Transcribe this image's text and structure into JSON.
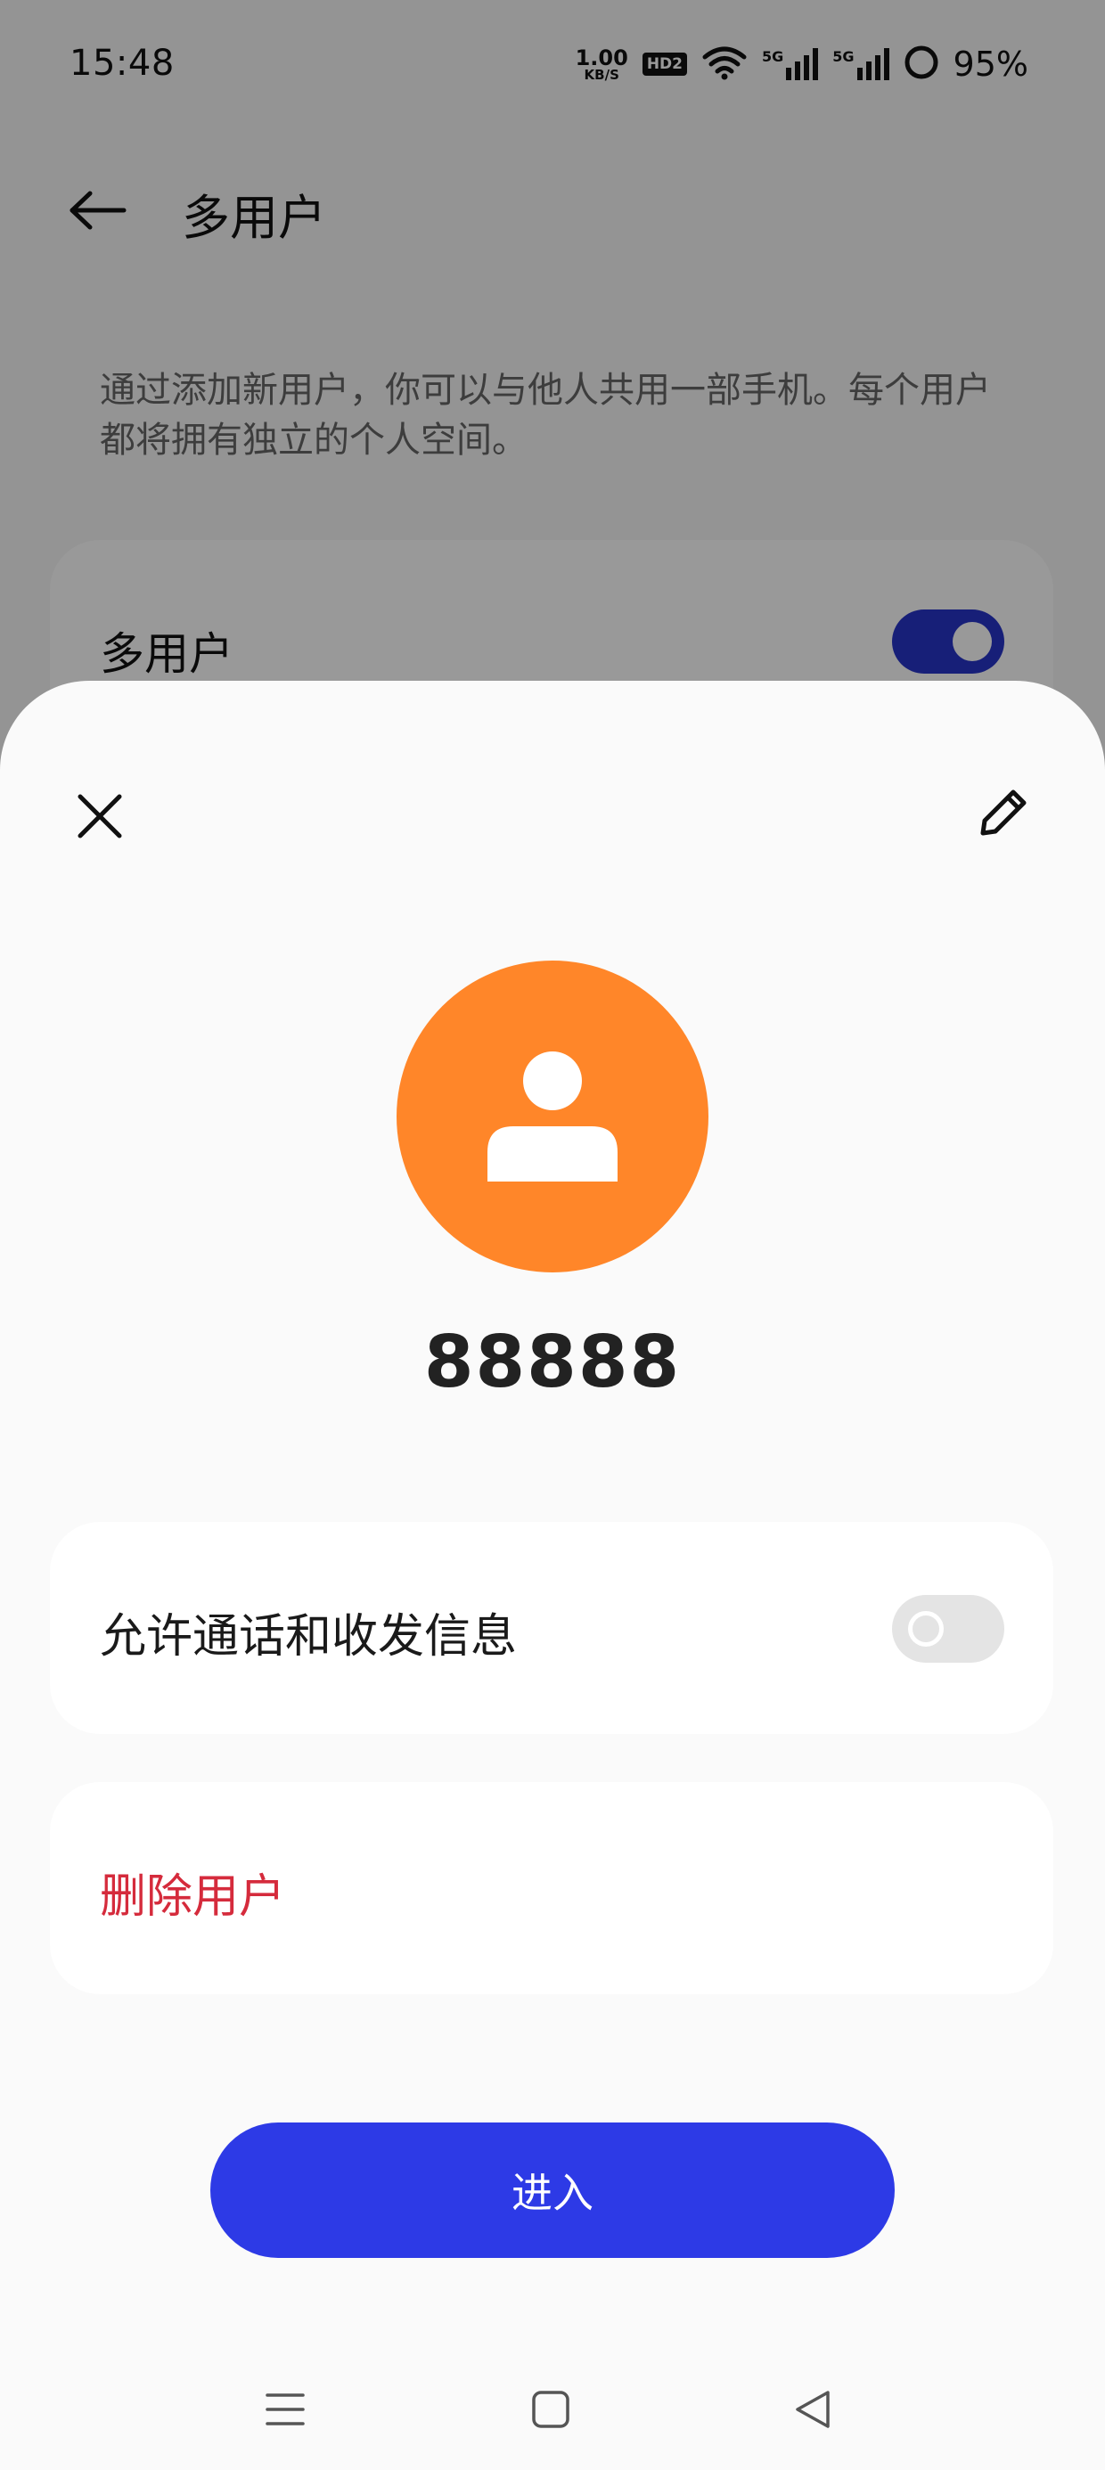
{
  "status_bar": {
    "time": "15:48",
    "net_speed_value": "1.00",
    "net_speed_unit": "KB/S",
    "hd_label": "HD2",
    "signal1_label": "5G",
    "signal2_label": "5G",
    "battery": "95%"
  },
  "header": {
    "title": "多用户",
    "back_icon": "arrow-left-icon"
  },
  "intro": "通过添加新用户，你可以与他人共用一部手机。每个用户都将拥有独立的个人空间。",
  "multi_user_card": {
    "label": "多用户",
    "enabled": true
  },
  "sheet": {
    "close_icon": "close-icon",
    "edit_icon": "pencil-icon",
    "avatar_color": "#ff8629",
    "user_name": "88888",
    "allow_calls": {
      "label": "允许通话和收发信息",
      "enabled": false
    },
    "delete_label": "删除用户",
    "enter_label": "进入"
  },
  "nav": {
    "menu_icon": "menu-icon",
    "home_icon": "home-icon",
    "back_icon": "back-triangle-icon"
  },
  "colors": {
    "accent": "#2d3ae6",
    "toggle_on": "#2734c8",
    "danger": "#d52b3c",
    "avatar": "#ff8629"
  }
}
